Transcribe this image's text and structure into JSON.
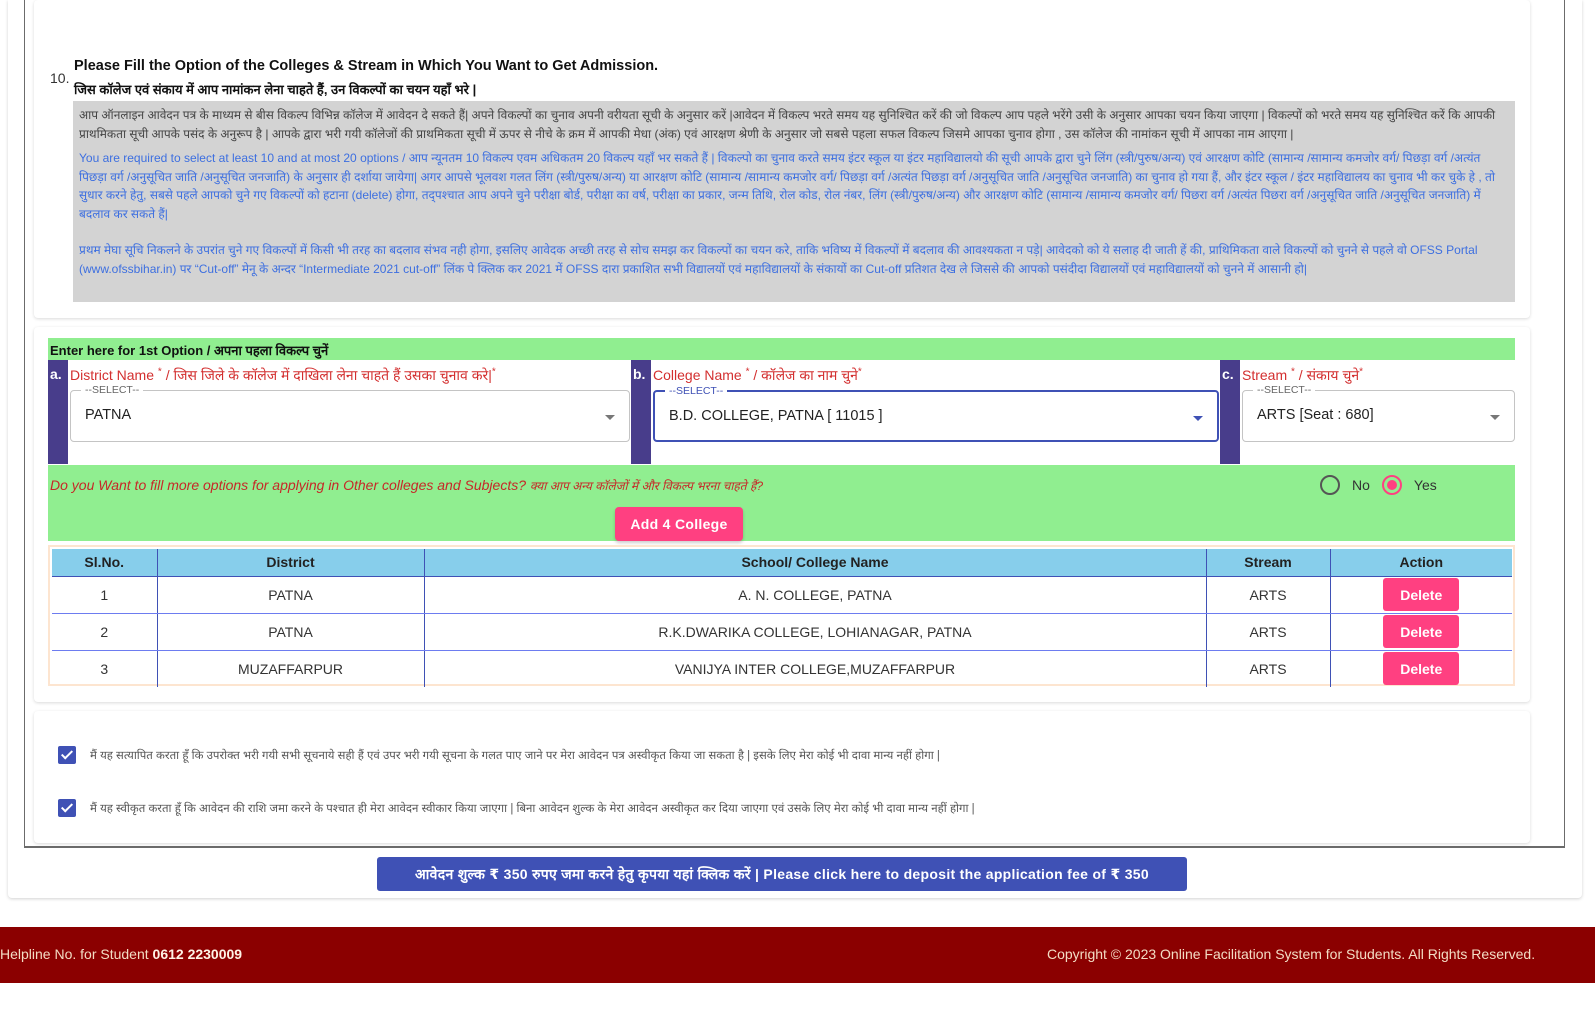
{
  "question": {
    "number": "10.",
    "title_en": "Please Fill the Option of the Colleges & Stream in Which You Want to Get Admission.",
    "title_hi": "जिस कॉलेज एवं संकाय में आप नामांकन लेना चाहते हैं, उन विकल्पों का चयन यहाँ भरे |"
  },
  "info": {
    "para1": "आप ऑनलाइन आवेदन पत्र के माध्यम से बीस विकल्प विभिन्न कॉलेज में आवेदन दे सकते हैं| अपने विकल्पों का चुनाव अपनी वरीयता सूची के अनुसार करें |आवेदन में विकल्प भरते समय यह सुनिश्चित करें की जो विकल्प आप पहले भरेंगे उसी के अनुसार आपका चयन किया जाएगा | विकल्पों को भरते समय यह सुनिश्चित करें कि आपकी प्राथमिकता सूची आपके पसंद के अनुरूप है | आपके द्वारा भरी गयी कॉलेजों की प्राथमिकता सूची में ऊपर से नीचे के क्रम में आपकी मेधा (अंक) एवं आरक्षण श्रेणी के अनुसार जो सबसे पहला सफल विकल्प जिसमे आपका चुनाव होगा , उस कॉलेज की नामांकन सूची में आपका नाम आएगा |",
    "para2": "You are required to select at least 10 and at most 20 options / आप न्यूनतम 10 विकल्प एवम अधिकतम 20 विकल्प यहाँ भर सकते हैं | विकल्पो का चुनाव करते समय इंटर स्कूल या इंटर महाविद्यालयो की सूची आपके द्वारा चुने लिंग (स्त्री/पुरुष/अन्य) एवं आरक्षण कोटि (सामान्य /सामान्य कमजोर वर्ग/ पिछड़ा वर्ग /अत्यंत पिछड़ा वर्ग /अनुसूचित जाति /अनुसूचित जनजाति) के अनुसार ही दर्शाया जायेगा| अगर आपसे भूलवश गलत लिंग (स्त्री/पुरुष/अन्य) या आरक्षण कोटि (सामान्य /सामान्य कमजोर वर्ग/ पिछड़ा वर्ग /अत्यंत पिछड़ा वर्ग /अनुसूचित जाति /अनुसूचित जनजाति) का चुनाव हो गया हैं, और इंटर स्कूल / इंटर महाविद्यालय का चुनाव भी कर चुके हे , तो सुधार करने हेतु, सबसे पहले आपको चुने गए विकल्पों को हटाना (delete) होगा, तद्पश्चात आप अपने चुने परीक्षा बोर्ड, परीक्षा का वर्ष, परीक्षा का प्रकार, जन्म तिथि, रोल कोड, रोल नंबर, लिंग (स्त्री/पुरुष/अन्य) और आरक्षण कोटि (सामान्य /सामान्य कमजोर वर्ग/ पिछरा वर्ग /अत्यंत पिछरा वर्ग /अनुसूचित जाति /अनुसूचित जनजाति) में बदलाव कर सकते हैं|",
    "para3": "प्रथम मेघा सूचि निकलने के उपरांत चुने गए विकल्पों में किसी भी तरह का बदलाव संभव नही होगा, इसलिए आवेदक अच्छी तरह से सोच समझ कर विकल्पों का चयन करे, ताकि भविष्य में विकल्पों में बदलाव की आवश्यकता न पड़े| आवेदको को ये सलाह दी जाती हें की, प्राथिमिकता वाले विकल्पों को चुनने से पहले वो OFSS Portal (www.ofssbihar.in) पर “Cut-off” मेनू के अन्दर “Intermediate 2021 cut-off” लिंक पे क्लिक कर 2021 में OFSS दारा प्रकाशित सभी विद्यालयों एवं महाविद्यालयों के संकायों का Cut-off प्रतिशत देख ले जिससे की आपको पसंदीदा विद्यालयों एवं महाविद्यालयों को चुनने में आसानी हो|"
  },
  "option_form": {
    "heading": "Enter here for 1st Option / अपना पहला विकल्प चुनें",
    "fields": [
      {
        "letter": "a.",
        "label": "District Name",
        "label_hi": " / जिस जिले के कॉलेज में दाखिला लेना चाहते हैं उसका चुनाव करे|",
        "legend": "--SELECT--",
        "value": "PATNA"
      },
      {
        "letter": "b.",
        "label": "College Name",
        "label_hi": " / कॉलेज का नाम चुने",
        "legend": "--SELECT--",
        "value": "B.D. COLLEGE, PATNA [ 11015 ]"
      },
      {
        "letter": "c.",
        "label": "Stream",
        "label_hi": " / संकाय चुने",
        "legend": "--SELECT--",
        "value": "ARTS [Seat : 680]"
      }
    ],
    "required_mark": "*"
  },
  "more_options": {
    "question_en": "Do you Want to fill more options for applying in Other colleges and Subjects?",
    "question_hi": "क्या आप अन्य कॉलेजों में और विकल्प भरना चाहते हैं?",
    "radio_no": "No",
    "radio_yes": "Yes",
    "selected": "Yes",
    "add_button": "Add 4 College"
  },
  "table": {
    "headers": [
      "Sl.No.",
      "District",
      "School/ College Name",
      "Stream",
      "Action"
    ],
    "rows": [
      {
        "sl": "1",
        "district": "PATNA",
        "college": "A. N. COLLEGE, PATNA",
        "stream": "ARTS",
        "action": "Delete"
      },
      {
        "sl": "2",
        "district": "PATNA",
        "college": "R.K.DWARIKA COLLEGE, LOHIANAGAR, PATNA",
        "stream": "ARTS",
        "action": "Delete"
      },
      {
        "sl": "3",
        "district": "MUZAFFARPUR",
        "college": "VANIJYA INTER COLLEGE,MUZAFFARPUR",
        "stream": "ARTS",
        "action": "Delete"
      }
    ]
  },
  "declarations": [
    {
      "checked": true,
      "text": "मैं यह सत्यापित करता हूँ कि उपरोक्त भरी गयी सभी सूचनाये सही हैं एवं उपर भरी गयी सूचना के गलत पाए जाने पर मेरा आवेदन पत्र अस्वीकृत किया जा सकता है | इसके लिए मेरा कोई भी दावा मान्य नहीं होगा |"
    },
    {
      "checked": true,
      "text": "मैं यह स्वीकृत करता हूँ कि आवेदन की राशि जमा करने के पश्चात ही मेरा आवेदन स्वीकार किया जाएगा | बिना आवेदन शुल्क के मेरा आवेदन अस्वीकृत कर दिया जाएगा एवं उसके लिए मेरा कोई भी दावा मान्य नहीं होगा |"
    }
  ],
  "pay_button": "आवेदन शुल्क ₹ 350 रुपए जमा करने हेतु कृपया यहां क्लिक करें | Please click here to deposit the application fee of ₹ 350",
  "footer": {
    "helpline_label": "Helpline No. for Student ",
    "helpline_number": "0612 2230009",
    "copyright": "Copyright © 2023 Online Facilitation System for Students. All Rights Reserved."
  },
  "colors": {
    "green_bar": "#90ee90",
    "primary": "#3f51b5",
    "accent_pink": "#ff4081",
    "footer_bg": "#8b0000",
    "letter_bg": "#483d8b",
    "table_header": "#87ceeb"
  }
}
